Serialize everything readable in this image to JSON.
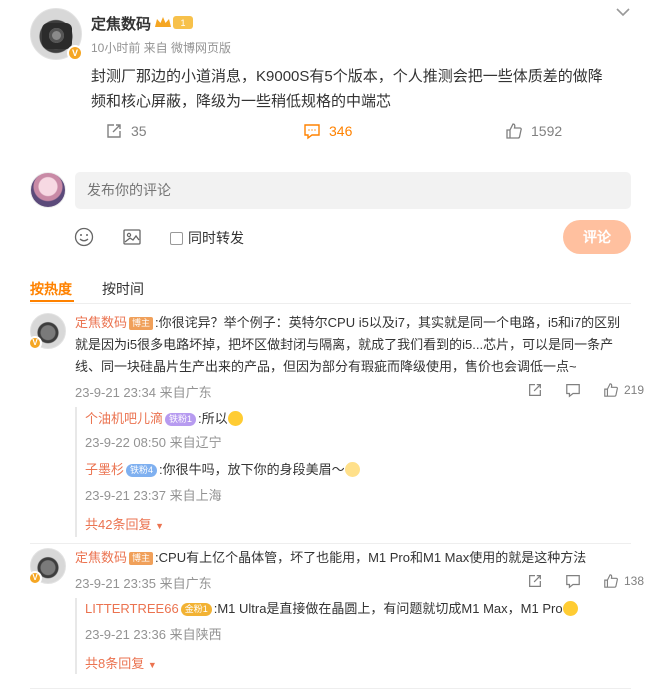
{
  "post": {
    "author": "定焦数码",
    "level_badge": "1",
    "meta": "10小时前 来自 微博网页版",
    "text": "封测厂那边的小道消息，K9000S有5个版本，个人推测会把一些体质差的做降频和核心屏蔽，降级为一些稍低规格的中端芯",
    "repost_count": "35",
    "comment_count": "346",
    "like_count": "1592"
  },
  "compose": {
    "placeholder": "发布你的评论",
    "repost_label": "同时转发",
    "submit_label": "评论"
  },
  "tabs": {
    "hot": "按热度",
    "time": "按时间"
  },
  "comments": [
    {
      "author": "定焦数码",
      "badge": "博主",
      "text": ":你很诧异？举个例子：英特尔CPU i5以及i7，其实就是同一个电路，i5和i7的区别就是因为i5很多电路坏掉，把坏区做封闭与隔离，就成了我们看到的i5...芯片，可以是同一条产线、同一块硅晶片生产出来的产品，但因为部分有瑕疵而降级使用，售价也会调低一点~",
      "meta": "23-9-21 23:34 来自广东",
      "likes": "219",
      "replies": [
        {
          "author": "个油机吧儿滴",
          "badge": "铁粉1",
          "text": ":所以",
          "meta": "23-9-22 08:50 来自辽宁"
        },
        {
          "author": "子墨杉",
          "badge": "铁粉4",
          "text": ":你很牛吗，放下你的身段美眉～",
          "meta": "23-9-21 23:37 来自上海"
        }
      ],
      "more": "共42条回复"
    },
    {
      "author": "定焦数码",
      "badge": "博主",
      "text": ":CPU有上亿个晶体管，坏了也能用，M1 Pro和M1 Max使用的就是这种方法",
      "meta": "23-9-21 23:35 来自广东",
      "likes": "138",
      "replies": [
        {
          "author": "LITTERTREE66",
          "badge": "金粉1",
          "text": ":M1 Ultra是直接做在晶圆上，有问题就切成M1 Max，M1 Pro",
          "meta": "23-9-21 23:36 来自陕西"
        }
      ],
      "more": "共8条回复"
    }
  ],
  "colors": {
    "accent": "#ff8200",
    "name": "#eb7350",
    "meta": "#939393"
  }
}
